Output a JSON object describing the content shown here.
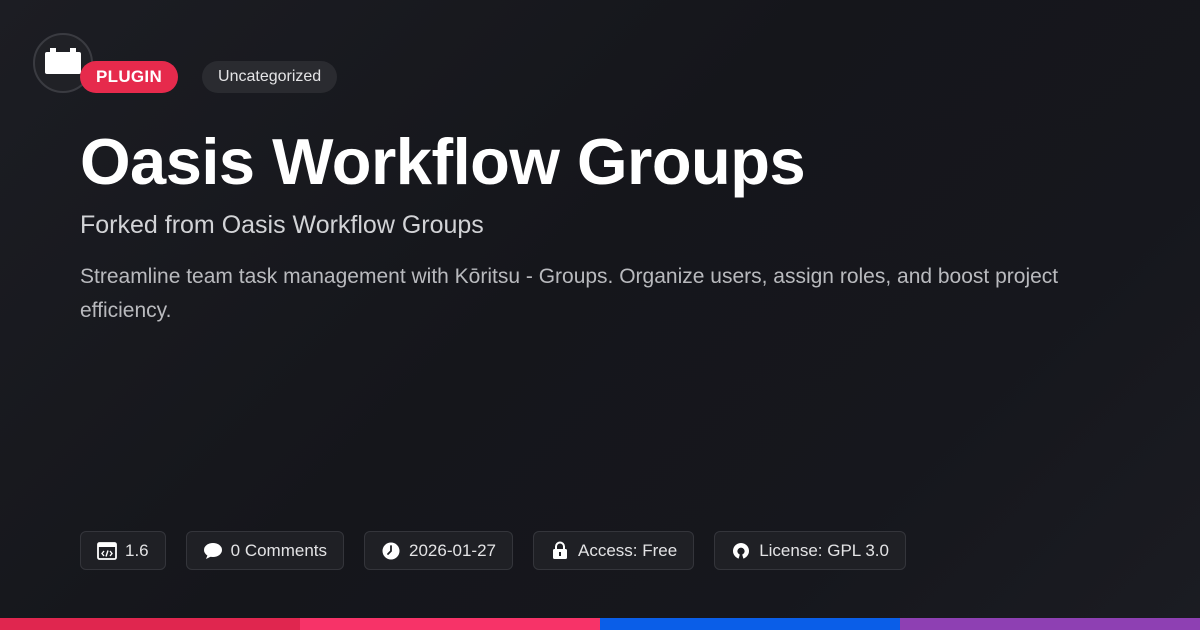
{
  "header": {
    "logo_icon": "plugin-block-icon",
    "type_badge": "PLUGIN",
    "category_badge": "Uncategorized"
  },
  "main": {
    "title": "Oasis Workflow Groups",
    "subtitle": "Forked from Oasis Workflow Groups",
    "description": "Streamline team task management with Kōritsu - Groups. Organize users, assign roles, and boost project efficiency."
  },
  "meta": {
    "version": {
      "icon": "code-window-icon",
      "label": "1.6"
    },
    "comments": {
      "icon": "speech-bubble-icon",
      "label": "0 Comments"
    },
    "date": {
      "icon": "clock-icon",
      "label": "2026-01-27"
    },
    "access": {
      "icon": "lock-icon",
      "label": "Access: Free"
    },
    "license": {
      "icon": "open-source-icon",
      "label": "License: GPL 3.0"
    }
  },
  "colors": {
    "accent": "#e62a4c",
    "bar": [
      "#e0264f",
      "#f73368",
      "#0a5ee8",
      "#8e40b3"
    ]
  }
}
